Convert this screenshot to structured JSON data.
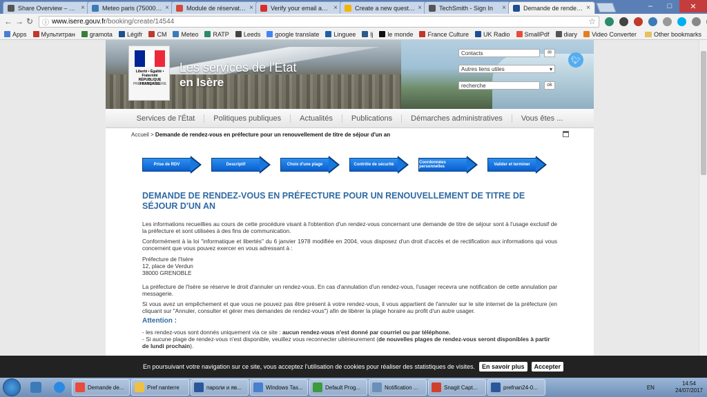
{
  "tabs": [
    {
      "label": "Share Overview – TechSmith",
      "color": "#555555",
      "active": false
    },
    {
      "label": "Meteo paris (75000 - FR",
      "color": "#3d7ab8",
      "active": false
    },
    {
      "label": "Module de réservation",
      "color": "#d04b3a",
      "active": false
    },
    {
      "label": "Verify your email address",
      "color": "#d93025",
      "active": false
    },
    {
      "label": "Create a new question or",
      "color": "#f4b400",
      "active": false
    },
    {
      "label": "TechSmith - Sign In",
      "color": "#555555",
      "active": false
    },
    {
      "label": "Demande de rendez-vous",
      "color": "#1d4f91",
      "active": true
    }
  ],
  "browser": {
    "url_domain": "www.isere.gouv.fr",
    "url_path": "/booking/create/14544",
    "star": "☆"
  },
  "bookmarks": [
    {
      "label": "Apps",
      "color": "#4a7fd0"
    },
    {
      "label": "Мультитран",
      "color": "#c0392b"
    },
    {
      "label": "gramota",
      "color": "#3a7d3a"
    },
    {
      "label": "Légifr",
      "color": "#1d4f91"
    },
    {
      "label": "CM",
      "color": "#c0392b"
    },
    {
      "label": "Meteo",
      "color": "#3d7ab8"
    },
    {
      "label": "RATP",
      "color": "#2b8a6e"
    },
    {
      "label": "Leeds",
      "color": "#444444"
    },
    {
      "label": "google translate",
      "color": "#4285f4"
    },
    {
      "label": "Linguee",
      "color": "#1f5fa7"
    },
    {
      "label": "lj",
      "color": "#2c5a8c"
    },
    {
      "label": "le monde",
      "color": "#111111"
    },
    {
      "label": "France Culture",
      "color": "#c0392b"
    },
    {
      "label": "UK Radio",
      "color": "#1d4f91"
    },
    {
      "label": "SmallPdf",
      "color": "#e74c3c"
    },
    {
      "label": "diary",
      "color": "#555555"
    },
    {
      "label": "Video Converter",
      "color": "#e67e22"
    }
  ],
  "bookmarks_other": "Other bookmarks",
  "header": {
    "logo_rf": "Liberté • Égalité • Fraternité RÉPUBLIQUE FRANÇAISE",
    "logo_prefet": "PRÉFET DE L'ISÈRE",
    "title_line1": "Les services de l'État",
    "title_line2": "en Isère",
    "contacts_placeholder": "Contacts",
    "other_links": "Autres liens utiles",
    "search_placeholder": "recherche",
    "search_button": "ok"
  },
  "nav": [
    "Services de l'État",
    "Politiques publiques",
    "Actualités",
    "Publications",
    "Démarches administratives",
    "Vous êtes ..."
  ],
  "breadcrumb": {
    "home": "Accueil",
    "sep": " > ",
    "current": "Demande de rendez-vous en préfecture pour un renouvellement de titre de séjour d'un an"
  },
  "steps": [
    "Prise de RDV",
    "Descriptif",
    "Choix d'une plage",
    "Contrôle de sécurité",
    "Coordonnées personnelles",
    "Valider et terminer"
  ],
  "page_title": "DEMANDE DE RENDEZ-VOUS EN PRÉFECTURE POUR UN RENOUVELLEMENT DE TITRE DE SÉJOUR D'UN AN",
  "content": {
    "p1": "Les informations recueillies au cours de cette procédure visant à l'obtention d'un rendez-vous concernant une demande de titre de séjour sont à l'usage exclusif de la préfecture et sont utilisées à des fins de communication.",
    "p2": "Conformément à la loi \"informatique et libertés\" du 6 janvier 1978 modifiée en 2004, vous disposez d'un droit d'accès et de rectification aux informations qui vous concernent que vous pouvez exercer en vous adressant à :",
    "addr1": "Préfecture de l'Isère",
    "addr2": "12, place de Verdun",
    "addr3": "38000 GRENOBLE",
    "p3": "La préfecture de l'Isère se réserve le droit d'annuler un rendez-vous. En cas d'annulation d'un rendez-vous, l'usager recevra une notification de cette annulation par messagerie.",
    "p4": "Si vous avez un empêchement et que vous ne pouvez pas être présent à votre rendez-vous, il vous appartient de l'annuler sur le site internet de la préfecture (en cliquant sur \"Annuler, consulter et gérer mes demandes de rendez-vous\") afin de libérer la plage horaire au profit d'un autre usager.",
    "attention": "Attention :",
    "li1_a": "- les rendez-vous sont donnés uniquement via ce site : ",
    "li1_b": "aucun rendez-vous n'est donné par courriel ou par téléphone.",
    "li2_a": "- Si aucune plage de rendez-vous n'est disponible, veuillez vous reconnecter ultérieurement (",
    "li2_b": "de nouvelles plages de rendez-vous seront disponibles à partir de lundi prochain",
    "li2_c": ")."
  },
  "cookie": {
    "text": "En poursuivant votre navigation sur ce site, vous acceptez l'utilisation de cookies pour réaliser des statistiques de visites.",
    "more": "En savoir plus",
    "accept": "Accepter"
  },
  "taskbar": {
    "items": [
      {
        "label": "Demande de...",
        "color": "#e74c3c"
      },
      {
        "label": "Pref nanterre",
        "color": "#f0c040"
      },
      {
        "label": "пароли и яв...",
        "color": "#2b579a"
      },
      {
        "label": "Windows Tas...",
        "color": "#4a7fd0"
      },
      {
        "label": "Default Prog...",
        "color": "#3d9a3d"
      },
      {
        "label": "Notification ...",
        "color": "#6a8fb8"
      },
      {
        "label": "Snagit Capt...",
        "color": "#d0402b"
      },
      {
        "label": "prefnan24-0...",
        "color": "#2b579a"
      }
    ],
    "lang": "EN",
    "time": "14:54",
    "date": "24/07/2017"
  }
}
